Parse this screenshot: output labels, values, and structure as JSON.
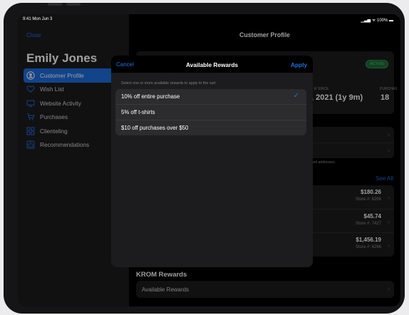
{
  "status_bar": {
    "time": "9:41  Mon Jun 3",
    "right": "▁▃▅ ᯤ 100% ▬"
  },
  "sidebar": {
    "close_label": "Close",
    "customer_name": "Emily Jones",
    "items": [
      {
        "label": "Customer Profile",
        "icon": "person-circle-icon",
        "active": true
      },
      {
        "label": "Wish List",
        "icon": "heart-icon",
        "active": false
      },
      {
        "label": "Website Activity",
        "icon": "monitor-icon",
        "active": false
      },
      {
        "label": "Purchases",
        "icon": "cart-icon",
        "active": false
      },
      {
        "label": "Clienteling",
        "icon": "grid-icon",
        "active": false
      },
      {
        "label": "Recommendations",
        "icon": "sparkle-box-icon",
        "active": false
      }
    ]
  },
  "content": {
    "title": "Customer Profile",
    "status_badge": "ACTIVE",
    "member_since_label": "R SINCE",
    "member_since_value": ", 2021 (1y 9m)",
    "purchases_label": "PURCHAS",
    "purchases_value": "18",
    "footnote": ", and addresses.",
    "see_all": "See All",
    "purchases": [
      {
        "amount": "$180.26",
        "store": "Store #: 6266"
      },
      {
        "amount": "$45.74",
        "store": "Store #: 7427"
      },
      {
        "amount": "$1,456.19",
        "store": "Store #: 6266"
      }
    ],
    "rewards_section_title": "KROM Rewards",
    "available_rewards_row": "Available Rewards"
  },
  "modal": {
    "cancel_label": "Cancel",
    "title": "Available Rewards",
    "apply_label": "Apply",
    "hint": "Select one or more available rewards to apply to the cart.",
    "rewards": [
      {
        "label": "10% off entire purchase",
        "selected": true
      },
      {
        "label": "5% off t-shirts",
        "selected": false
      },
      {
        "label": "$10 off purchases over $50",
        "selected": false
      }
    ]
  },
  "colors": {
    "accent": "#1e6fe0",
    "badge_green": "#44d07a",
    "panel": "#1c1c1e"
  }
}
